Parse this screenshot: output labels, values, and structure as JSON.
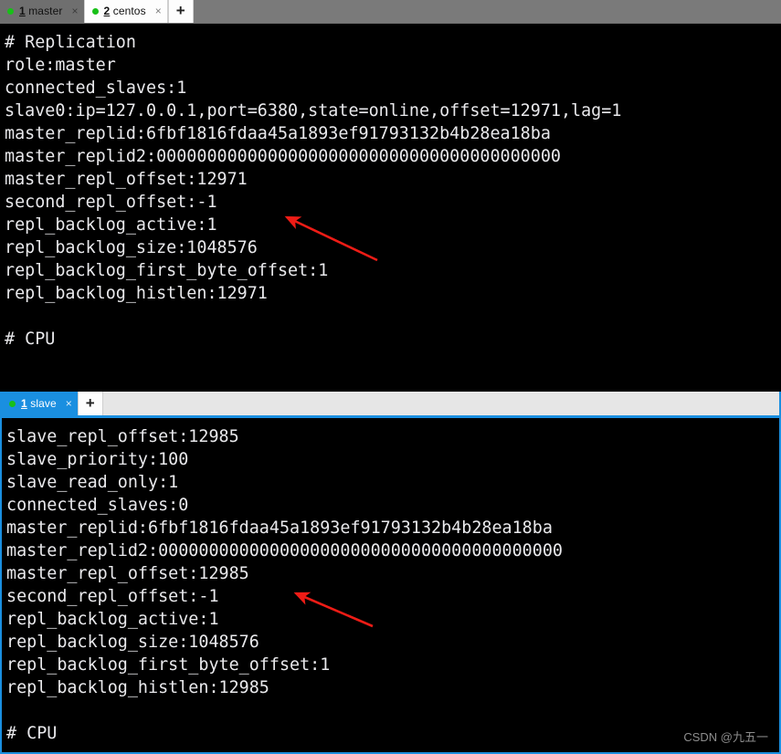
{
  "windows": [
    {
      "name": "master-window",
      "tabbar": {
        "style": "gray",
        "tabs": [
          {
            "num": "1",
            "name": " master",
            "state": "inactive",
            "dot_color": "#18c018",
            "close_label": "×"
          },
          {
            "num": "2",
            "name": " centos",
            "state": "active",
            "dot_color": "#18c018",
            "close_label": "×"
          }
        ],
        "add_label": "+"
      },
      "lines": [
        "# Replication",
        "role:master",
        "connected_slaves:1",
        "slave0:ip=127.0.0.1,port=6380,state=online,offset=12971,lag=1",
        "master_replid:6fbf1816fdaa45a1893ef91793132b4b28ea18ba",
        "master_replid2:0000000000000000000000000000000000000000",
        "master_repl_offset:12971",
        "second_repl_offset:-1",
        "repl_backlog_active:1",
        "repl_backlog_size:1048576",
        "repl_backlog_first_byte_offset:1",
        "repl_backlog_histlen:12971",
        "",
        "# CPU"
      ]
    },
    {
      "name": "slave-window",
      "tabbar": {
        "style": "light",
        "tabs": [
          {
            "num": "1",
            "name": " slave",
            "state": "active-blue",
            "dot_color": "#18c018",
            "close_label": "×"
          }
        ],
        "add_label": "+"
      },
      "lines": [
        "slave_repl_offset:12985",
        "slave_priority:100",
        "slave_read_only:1",
        "connected_slaves:0",
        "master_replid:6fbf1816fdaa45a1893ef91793132b4b28ea18ba",
        "master_replid2:0000000000000000000000000000000000000000",
        "master_repl_offset:12985",
        "second_repl_offset:-1",
        "repl_backlog_active:1",
        "repl_backlog_size:1048576",
        "repl_backlog_first_byte_offset:1",
        "repl_backlog_histlen:12985",
        "",
        "# CPU"
      ]
    }
  ],
  "annotations": {
    "arrow_color": "#ee1c16",
    "arrows": [
      {
        "name": "master-repl-offset-arrow",
        "target_line": "master_repl_offset:12971"
      },
      {
        "name": "slave-master-repl-offset-arrow",
        "target_line": "master_repl_offset:12985"
      }
    ]
  },
  "watermark": {
    "text": "CSDN @九五一"
  },
  "colors": {
    "terminal_bg": "#000000",
    "terminal_fg": "#e9e9ec",
    "tabbar_gray": "#7a7a7a",
    "tabbar_light": "#e6e6e6",
    "accent_blue": "#1a8fe0",
    "tab_dot_green": "#18c018",
    "arrow_red": "#ee1c16"
  }
}
